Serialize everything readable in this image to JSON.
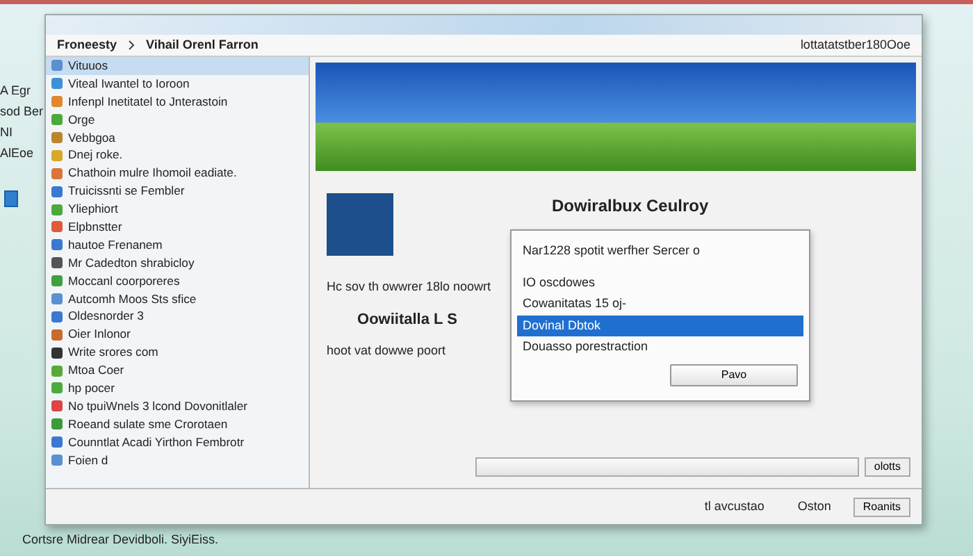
{
  "desktop": {
    "labels": [
      "A Egr",
      "sod Ber",
      "NI",
      "AlEoe"
    ],
    "footer": "Cortsre Midrear Devidboli. SiyiEiss."
  },
  "window": {
    "breadcrumb": [
      "Froneesty",
      "Vihail Orenl Farron"
    ],
    "address": "lottatatstber180Ooe"
  },
  "sidebar": {
    "items": [
      {
        "label": "Vituuos",
        "selected": true
      },
      {
        "label": "Viteal Iwantel to Ioroon",
        "selected": false
      },
      {
        "label": "Infenpl Inetitatel to Jnterastoin",
        "selected": false
      },
      {
        "label": "Orge",
        "selected": false
      },
      {
        "label": "Vebbgoa",
        "selected": false
      },
      {
        "label": "Dnej roke.",
        "selected": false
      },
      {
        "label": "Chathoin mulre Ihomoil eadiate.",
        "selected": false
      },
      {
        "label": "Truicissnti se Fembler",
        "selected": false
      },
      {
        "label": "Yliephiort",
        "selected": false
      },
      {
        "label": "Elpbnstter",
        "selected": false
      },
      {
        "label": "hautoe Frenanem",
        "selected": false
      },
      {
        "label": "Mr Cadedton shrabicloy",
        "selected": false
      },
      {
        "label": "Moccanl coorporeres",
        "selected": false
      },
      {
        "label": "Autcomh Moos Sts sfice",
        "selected": false
      },
      {
        "label": "Oldesnorder 3",
        "selected": false
      },
      {
        "label": "Oier Inlonor",
        "selected": false
      },
      {
        "label": "Write srores com",
        "selected": false
      },
      {
        "label": "Mtoa Coer",
        "selected": false
      },
      {
        "label": "hp pocer",
        "selected": false
      },
      {
        "label": "No tpuiWnels 3 lcond Dovonitlaler",
        "selected": false
      },
      {
        "label": "Roeand sulate sme Crorotaen",
        "selected": false
      },
      {
        "label": "Counntlat Acadi Yirthon Fembrotr",
        "selected": false
      },
      {
        "label": "Foien d",
        "selected": false
      }
    ]
  },
  "content": {
    "heading": "Dowiralbux Ceulroy",
    "lines": [
      "Hc sov th owwrer 18lo noowrt",
      "Oowiitalla L S",
      "hoot vat dowwe poort"
    ]
  },
  "dialog": {
    "title": "Nar1228 spotit werfher Sercer o",
    "options": [
      {
        "label": "IO oscdowes",
        "selected": false
      },
      {
        "label": "Cowanitatas 15 oj-",
        "selected": false
      },
      {
        "label": "Dovinal Dbtok",
        "selected": true
      },
      {
        "label": "Douasso porestraction",
        "selected": false
      }
    ],
    "button": "Pavo"
  },
  "bottom_field": {
    "button": "olotts"
  },
  "status_bar": {
    "items": [
      "tl avcustao",
      "Oston"
    ],
    "button": "Roanits"
  }
}
